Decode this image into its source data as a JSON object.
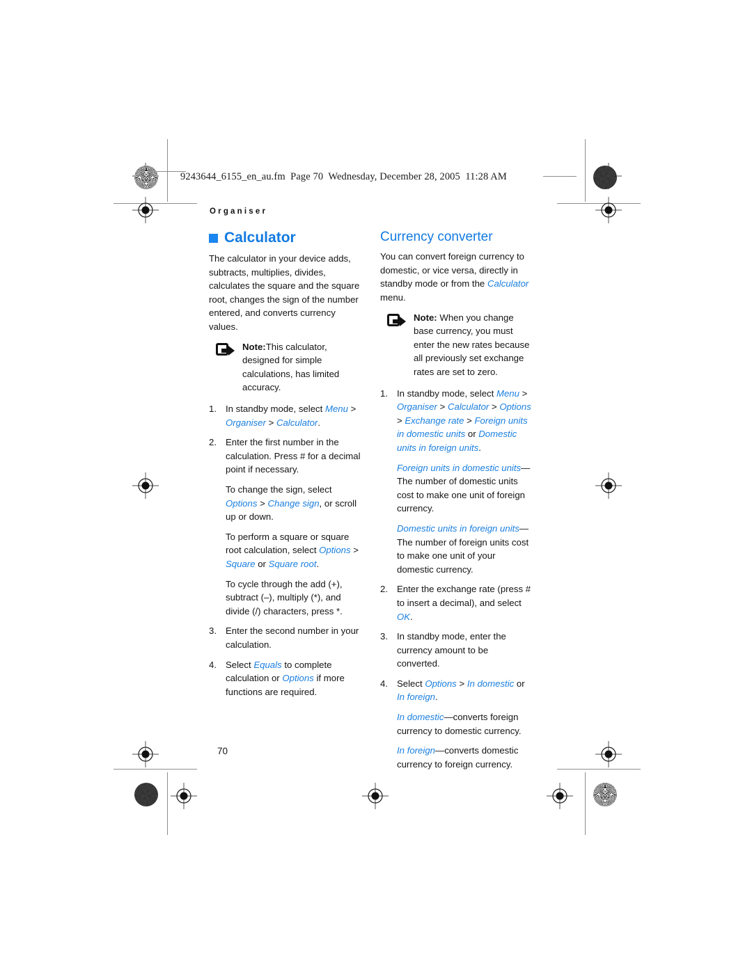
{
  "page": {
    "fm_header": "9243644_6155_en_au.fm  Page 70  Wednesday, December 28, 2005  11:28 AM",
    "running_head": "Organiser",
    "folio": "70",
    "accent_color": "#127ae0",
    "bullet_color": "#1a86f0",
    "text_color": "#141414"
  },
  "left_column": {
    "heading": "Calculator",
    "intro": "The calculator in your device adds, subtracts, multiplies, divides, calculates the square and the square root, changes the sign of the number entered, and converts currency values.",
    "note": {
      "label": "Note:",
      "text": "This calculator, designed for simple calculations, has limited accuracy.",
      "icon": "note-arrow-icon"
    },
    "steps": [
      {
        "num": "1.",
        "parts": [
          {
            "t": "In standby mode, select ",
            "s": "plain"
          },
          {
            "t": "Menu",
            "s": "bi"
          },
          {
            "t": " > ",
            "s": "plain"
          },
          {
            "t": "Organiser",
            "s": "bi"
          },
          {
            "t": " > ",
            "s": "plain"
          },
          {
            "t": "Calculator",
            "s": "bi"
          },
          {
            "t": ".",
            "s": "plain"
          }
        ],
        "subs": []
      },
      {
        "num": "2.",
        "parts": [
          {
            "t": "Enter the first number in the calculation. Press # for a decimal point if necessary.",
            "s": "plain"
          }
        ],
        "subs": [
          [
            {
              "t": "To change the sign, select ",
              "s": "plain"
            },
            {
              "t": "Options",
              "s": "bi"
            },
            {
              "t": " > ",
              "s": "plain"
            },
            {
              "t": "Change sign",
              "s": "bi"
            },
            {
              "t": ", or scroll up or down.",
              "s": "plain"
            }
          ],
          [
            {
              "t": "To perform a square or square root calculation, select ",
              "s": "plain"
            },
            {
              "t": "Options",
              "s": "bi"
            },
            {
              "t": " > ",
              "s": "plain"
            },
            {
              "t": "Square",
              "s": "bi"
            },
            {
              "t": " or ",
              "s": "plain"
            },
            {
              "t": "Square root",
              "s": "bi"
            },
            {
              "t": ".",
              "s": "plain"
            }
          ],
          [
            {
              "t": "To cycle through the add (+), subtract (–), multiply (*), and divide (/) characters, press *.",
              "s": "plain"
            }
          ]
        ]
      },
      {
        "num": "3.",
        "parts": [
          {
            "t": "Enter the second number in your calculation.",
            "s": "plain"
          }
        ],
        "subs": []
      },
      {
        "num": "4.",
        "parts": [
          {
            "t": "Select ",
            "s": "plain"
          },
          {
            "t": "Equals",
            "s": "bi"
          },
          {
            "t": " to complete calculation or ",
            "s": "plain"
          },
          {
            "t": "Options",
            "s": "bi"
          },
          {
            "t": " if more functions are required.",
            "s": "plain"
          }
        ],
        "subs": []
      }
    ]
  },
  "right_column": {
    "heading": "Currency converter",
    "intro_parts": [
      {
        "t": "You can convert foreign currency to domestic, or vice versa, directly in standby mode or from the ",
        "s": "plain"
      },
      {
        "t": "Calculator",
        "s": "bi"
      },
      {
        "t": " menu.",
        "s": "plain"
      }
    ],
    "note": {
      "label": "Note:",
      "text": "When you change base currency, you must enter the new rates because all previously set exchange rates are set to zero.",
      "icon": "note-arrow-icon"
    },
    "steps": [
      {
        "num": "1.",
        "parts": [
          {
            "t": "In standby mode, select ",
            "s": "plain"
          },
          {
            "t": "Menu",
            "s": "bi"
          },
          {
            "t": " > ",
            "s": "plain"
          },
          {
            "t": "Organiser",
            "s": "bi"
          },
          {
            "t": " > ",
            "s": "plain"
          },
          {
            "t": "Calculator",
            "s": "bi"
          },
          {
            "t": " > ",
            "s": "plain"
          },
          {
            "t": "Options",
            "s": "bi"
          },
          {
            "t": " > ",
            "s": "plain"
          },
          {
            "t": "Exchange rate",
            "s": "bi"
          },
          {
            "t": " > ",
            "s": "plain"
          },
          {
            "t": "Foreign units in domestic units",
            "s": "bi"
          },
          {
            "t": " or ",
            "s": "plain"
          },
          {
            "t": "Domestic units in foreign units",
            "s": "bi"
          },
          {
            "t": ".",
            "s": "plain"
          }
        ],
        "subs": [
          [
            {
              "t": "Foreign units in domestic units",
              "s": "bi"
            },
            {
              "t": "—The number of domestic units cost to make one unit of foreign currency.",
              "s": "plain"
            }
          ],
          [
            {
              "t": "Domestic units in foreign units",
              "s": "bi"
            },
            {
              "t": "—The number of foreign units cost to make one unit of your domestic currency.",
              "s": "plain"
            }
          ]
        ]
      },
      {
        "num": "2.",
        "parts": [
          {
            "t": "Enter the exchange rate (press # to insert a decimal), and select ",
            "s": "plain"
          },
          {
            "t": "OK",
            "s": "bi"
          },
          {
            "t": ".",
            "s": "plain"
          }
        ],
        "subs": []
      },
      {
        "num": "3.",
        "parts": [
          {
            "t": "In standby mode, enter the currency amount to be converted.",
            "s": "plain"
          }
        ],
        "subs": []
      },
      {
        "num": "4.",
        "parts": [
          {
            "t": "Select ",
            "s": "plain"
          },
          {
            "t": "Options",
            "s": "bi"
          },
          {
            "t": " > ",
            "s": "plain"
          },
          {
            "t": "In domestic",
            "s": "bi"
          },
          {
            "t": " or ",
            "s": "plain"
          },
          {
            "t": "In foreign",
            "s": "bi"
          },
          {
            "t": ".",
            "s": "plain"
          }
        ],
        "subs": [
          [
            {
              "t": "In domestic",
              "s": "bi"
            },
            {
              "t": "—converts foreign currency to domestic currency.",
              "s": "plain"
            }
          ],
          [
            {
              "t": "In foreign",
              "s": "bi"
            },
            {
              "t": "—converts domestic currency to foreign currency.",
              "s": "plain"
            }
          ]
        ]
      }
    ]
  },
  "print_marks": {
    "registration_targets": 10,
    "moire_patches": 4
  }
}
